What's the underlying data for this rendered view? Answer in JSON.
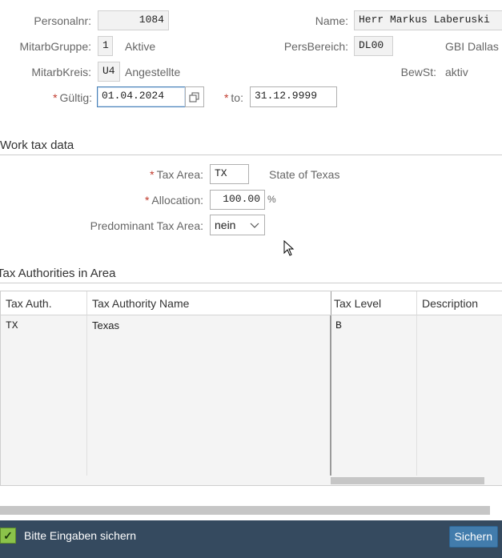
{
  "header": {
    "personalnr": {
      "label": "Personalnr:",
      "value": "1084"
    },
    "name": {
      "label": "Name:",
      "value": "Herr Markus Laberuski"
    },
    "mitarbgruppe": {
      "label": "MitarbGruppe:",
      "code": "1",
      "text": "Aktive"
    },
    "persbereich": {
      "label": "PersBereich:",
      "code": "DL00",
      "text": "GBI Dallas"
    },
    "mitarbkreis": {
      "label": "MitarbKreis:",
      "code": "U4",
      "text": "Angestellte"
    },
    "bewst": {
      "label": "BewSt:",
      "text": "aktiv"
    },
    "gueltig": {
      "label": "Gültig:",
      "value": "01.04.2024"
    },
    "to": {
      "label": "to:",
      "value": "31.12.9999"
    },
    "required_marker": "*"
  },
  "work_tax": {
    "title": "Work tax data",
    "tax_area": {
      "label": "Tax Area:",
      "value": "TX",
      "text": "State of Texas"
    },
    "allocation": {
      "label": "Allocation:",
      "value": "100.00",
      "unit": "%"
    },
    "predominant": {
      "label": "Predominant Tax Area:",
      "value": "nein"
    }
  },
  "authorities": {
    "title": "Tax Authorities in Area",
    "columns": [
      "Tax Auth.",
      "Tax Authority Name",
      "Tax Level",
      "Description"
    ],
    "rows": [
      [
        "TX",
        "Texas",
        "B",
        ""
      ],
      [
        "",
        "",
        "",
        ""
      ],
      [
        "",
        "",
        "",
        ""
      ],
      [
        "",
        "",
        "",
        ""
      ],
      [
        "",
        "",
        "",
        ""
      ],
      [
        "",
        "",
        "",
        ""
      ],
      [
        "",
        "",
        "",
        ""
      ],
      [
        "",
        "",
        "",
        ""
      ]
    ]
  },
  "statusbar": {
    "message": "Bitte Eingaben sichern",
    "save_label": "Sichern",
    "check_glyph": "✓"
  },
  "icons": {
    "calendar": "copy-calendar-icon",
    "dropdown": "chevron-down-icon",
    "cursor": "mouse-pointer-icon"
  }
}
